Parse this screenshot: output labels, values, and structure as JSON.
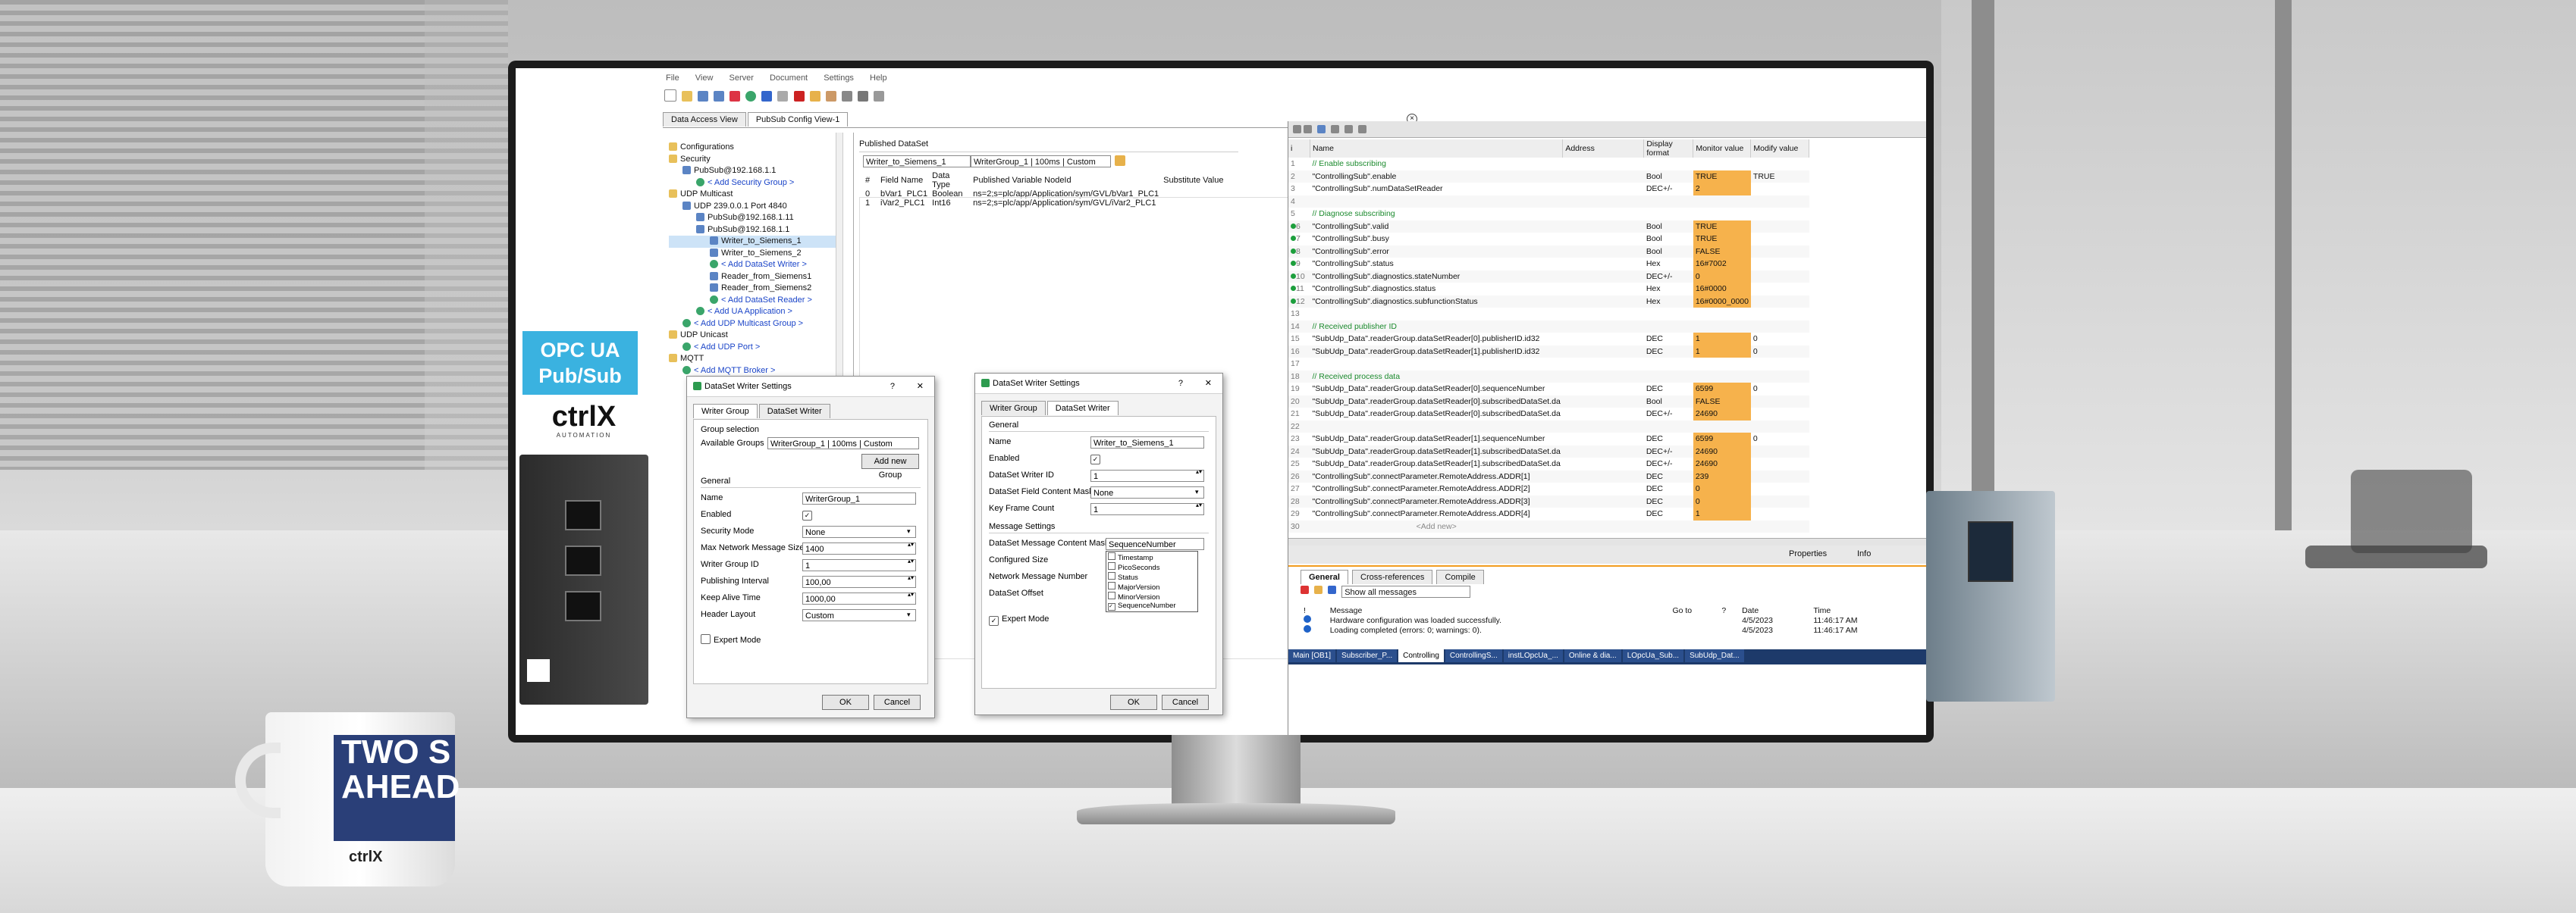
{
  "marketing": {
    "badge_line1": "OPC UA",
    "badge_line2": "Pub/Sub",
    "brand_logo_text": "ctrlX",
    "brand_sub": "AUTOMATION",
    "mug_text_1": "TWO S",
    "mug_text_2": "AHEAD",
    "mug_logo": "ctrlX"
  },
  "left_app": {
    "menu": [
      "File",
      "View",
      "Server",
      "Document",
      "Settings",
      "Help"
    ],
    "tabs": [
      "Data Access View",
      "PubSub Config View-1"
    ],
    "tree": [
      {
        "label": "Configurations",
        "indent": 0,
        "icon": "folder"
      },
      {
        "label": "Security",
        "indent": 0,
        "icon": "folder"
      },
      {
        "label": "PubSub@192.168.1.1",
        "indent": 1,
        "icon": "node"
      },
      {
        "label": "< Add Security Group >",
        "indent": 2,
        "icon": "plus",
        "link": true
      },
      {
        "label": "UDP Multicast",
        "indent": 0,
        "icon": "folder"
      },
      {
        "label": "UDP 239.0.0.1 Port 4840",
        "indent": 1,
        "icon": "node"
      },
      {
        "label": "PubSub@192.168.1.11",
        "indent": 2,
        "icon": "node"
      },
      {
        "label": "PubSub@192.168.1.1",
        "indent": 2,
        "icon": "node"
      },
      {
        "label": "Writer_to_Siemens_1",
        "indent": 3,
        "icon": "node",
        "selected": true
      },
      {
        "label": "Writer_to_Siemens_2",
        "indent": 3,
        "icon": "node"
      },
      {
        "label": "< Add DataSet Writer >",
        "indent": 3,
        "icon": "plus",
        "link": true
      },
      {
        "label": "Reader_from_Siemens1",
        "indent": 3,
        "icon": "node"
      },
      {
        "label": "Reader_from_Siemens2",
        "indent": 3,
        "icon": "node"
      },
      {
        "label": "< Add DataSet Reader >",
        "indent": 3,
        "icon": "plus",
        "link": true
      },
      {
        "label": "< Add UA Application >",
        "indent": 2,
        "icon": "plus",
        "link": true
      },
      {
        "label": "< Add UDP Multicast Group >",
        "indent": 1,
        "icon": "plus",
        "link": true
      },
      {
        "label": "UDP Unicast",
        "indent": 0,
        "icon": "folder"
      },
      {
        "label": "< Add UDP Port >",
        "indent": 1,
        "icon": "plus",
        "link": true
      },
      {
        "label": "MQTT",
        "indent": 0,
        "icon": "folder"
      },
      {
        "label": "< Add MQTT Broker >",
        "indent": 1,
        "icon": "plus",
        "link": true
      }
    ],
    "published": {
      "title": "Published DataSet",
      "writer_value": "Writer_to_Siemens_1",
      "group_value": "WriterGroup_1 | 100ms | Custom",
      "headers": [
        "#",
        "Field Name",
        "Data Type",
        "Published Variable NodeId",
        "Substitute Value"
      ],
      "rows": [
        [
          "0",
          "bVar1_PLC1",
          "Boolean",
          "ns=2;s=plc/app/Application/sym/GVL/bVar1_PLC1",
          ""
        ],
        [
          "1",
          "iVar2_PLC1",
          "Int16",
          "ns=2;s=plc/app/Application/sym/GVL/iVar2_PLC1",
          ""
        ]
      ]
    }
  },
  "dialog1": {
    "title": "DataSet Writer Settings",
    "tabs": [
      "Writer Group",
      "DataSet Writer"
    ],
    "group_selection": "Group selection",
    "available_groups_label": "Available Groups",
    "available_groups_value": "WriterGroup_1 | 100ms | Custom",
    "add_new_group": "Add new Group",
    "general": "General",
    "fields": [
      {
        "label": "Name",
        "value": "WriterGroup_1",
        "kind": "text"
      },
      {
        "label": "Enabled",
        "value": "",
        "kind": "check"
      },
      {
        "label": "Security Mode",
        "value": "None",
        "kind": "select"
      },
      {
        "label": "Max Network Message Size",
        "value": "1400",
        "kind": "spin"
      },
      {
        "label": "Writer Group ID",
        "value": "1",
        "kind": "spin"
      },
      {
        "label": "Publishing Interval",
        "value": "100,00",
        "kind": "spin"
      },
      {
        "label": "Keep Alive Time",
        "value": "1000,00",
        "kind": "spin"
      },
      {
        "label": "Header Layout",
        "value": "Custom",
        "kind": "select"
      }
    ],
    "expert_mode": "Expert Mode",
    "ok": "OK",
    "cancel": "Cancel"
  },
  "dialog2": {
    "title": "DataSet Writer Settings",
    "tabs": [
      "Writer Group",
      "DataSet Writer"
    ],
    "general": "General",
    "fields": [
      {
        "label": "Name",
        "value": "Writer_to_Siemens_1",
        "kind": "text"
      },
      {
        "label": "Enabled",
        "value": "",
        "kind": "check"
      },
      {
        "label": "DataSet Writer ID",
        "value": "1",
        "kind": "spin"
      },
      {
        "label": "DataSet Field Content Mask",
        "value": "None",
        "kind": "select"
      },
      {
        "label": "Key Frame Count",
        "value": "1",
        "kind": "spin"
      }
    ],
    "message_settings": "Message Settings",
    "msg_fields": [
      {
        "label": "DataSet Message Content Mask",
        "value": "SequenceNumber"
      },
      {
        "label": "Configured Size",
        "value": ""
      },
      {
        "label": "Network Message Number",
        "value": ""
      },
      {
        "label": "DataSet Offset",
        "value": ""
      }
    ],
    "mask_options": [
      "Timestamp",
      "PicoSeconds",
      "Status",
      "MajorVersion",
      "MinorVersion",
      "SequenceNumber"
    ],
    "expert_mode": "Expert Mode",
    "ok": "OK",
    "cancel": "Cancel"
  },
  "right_app": {
    "headers": [
      "i",
      "Name",
      "Address",
      "Display format",
      "Monitor value",
      "Modify value"
    ],
    "rows": [
      {
        "n": "1",
        "name": "// Enable subscribing",
        "fmt": "",
        "mon": "",
        "mod": "",
        "comment": true
      },
      {
        "n": "2",
        "name": "\"ControllingSub\".enable",
        "fmt": "Bool",
        "mon": "TRUE",
        "mod": "TRUE",
        "led": false
      },
      {
        "n": "3",
        "name": "\"ControllingSub\".numDataSetReader",
        "fmt": "DEC+/-",
        "mon": "2",
        "mod": ""
      },
      {
        "n": "4",
        "name": "",
        "fmt": "",
        "mon": "",
        "mod": ""
      },
      {
        "n": "5",
        "name": "// Diagnose subscribing",
        "fmt": "",
        "mon": "",
        "mod": "",
        "comment": true
      },
      {
        "n": "6",
        "name": "\"ControllingSub\".valid",
        "fmt": "Bool",
        "mon": "TRUE",
        "mod": "",
        "led": true
      },
      {
        "n": "7",
        "name": "\"ControllingSub\".busy",
        "fmt": "Bool",
        "mon": "TRUE",
        "mod": "",
        "led": true
      },
      {
        "n": "8",
        "name": "\"ControllingSub\".error",
        "fmt": "Bool",
        "mon": "FALSE",
        "mod": "",
        "led": true
      },
      {
        "n": "9",
        "name": "\"ControllingSub\".status",
        "fmt": "Hex",
        "mon": "16#7002",
        "mod": "",
        "led": true
      },
      {
        "n": "10",
        "name": "\"ControllingSub\".diagnostics.stateNumber",
        "fmt": "DEC+/-",
        "mon": "0",
        "mod": "",
        "led": true
      },
      {
        "n": "11",
        "name": "\"ControllingSub\".diagnostics.status",
        "fmt": "Hex",
        "mon": "16#0000",
        "mod": "",
        "led": true
      },
      {
        "n": "12",
        "name": "\"ControllingSub\".diagnostics.subfunctionStatus",
        "fmt": "Hex",
        "mon": "16#0000_0000",
        "mod": "",
        "led": true
      },
      {
        "n": "13",
        "name": "",
        "fmt": "",
        "mon": "",
        "mod": ""
      },
      {
        "n": "14",
        "name": "// Received publisher ID",
        "fmt": "",
        "mon": "",
        "mod": "",
        "comment": true
      },
      {
        "n": "15",
        "name": "\"SubUdp_Data\".readerGroup.dataSetReader[0].publisherID.id32",
        "fmt": "DEC",
        "mon": "1",
        "mod": "0"
      },
      {
        "n": "16",
        "name": "\"SubUdp_Data\".readerGroup.dataSetReader[1].publisherID.id32",
        "fmt": "DEC",
        "mon": "1",
        "mod": "0"
      },
      {
        "n": "17",
        "name": "",
        "fmt": "",
        "mon": "",
        "mod": ""
      },
      {
        "n": "18",
        "name": "// Received process data",
        "fmt": "",
        "mon": "",
        "mod": "",
        "comment": true
      },
      {
        "n": "19",
        "name": "\"SubUdp_Data\".readerGroup.dataSetReader[0].sequenceNumber",
        "fmt": "DEC",
        "mon": "6599",
        "mod": "0"
      },
      {
        "n": "20",
        "name": "\"SubUdp_Data\".readerGroup.dataSetReader[0].subscribedDataSet.da",
        "fmt": "Bool",
        "mon": "FALSE",
        "mod": ""
      },
      {
        "n": "21",
        "name": "\"SubUdp_Data\".readerGroup.dataSetReader[0].subscribedDataSet.da",
        "fmt": "DEC+/-",
        "mon": "24690",
        "mod": ""
      },
      {
        "n": "22",
        "name": "",
        "fmt": "",
        "mon": "",
        "mod": ""
      },
      {
        "n": "23",
        "name": "\"SubUdp_Data\".readerGroup.dataSetReader[1].sequenceNumber",
        "fmt": "DEC",
        "mon": "6599",
        "mod": "0"
      },
      {
        "n": "24",
        "name": "\"SubUdp_Data\".readerGroup.dataSetReader[1].subscribedDataSet.da",
        "fmt": "DEC+/-",
        "mon": "24690",
        "mod": ""
      },
      {
        "n": "25",
        "name": "\"SubUdp_Data\".readerGroup.dataSetReader[1].subscribedDataSet.da",
        "fmt": "DEC+/-",
        "mon": "24690",
        "mod": ""
      },
      {
        "n": "26",
        "name": "\"ControllingSub\".connectParameter.RemoteAddress.ADDR[1]",
        "fmt": "DEC",
        "mon": "239",
        "mod": ""
      },
      {
        "n": "27",
        "name": "\"ControllingSub\".connectParameter.RemoteAddress.ADDR[2]",
        "fmt": "DEC",
        "mon": "0",
        "mod": ""
      },
      {
        "n": "28",
        "name": "\"ControllingSub\".connectParameter.RemoteAddress.ADDR[3]",
        "fmt": "DEC",
        "mon": "0",
        "mod": ""
      },
      {
        "n": "29",
        "name": "\"ControllingSub\".connectParameter.RemoteAddress.ADDR[4]",
        "fmt": "DEC",
        "mon": "1",
        "mod": ""
      },
      {
        "n": "30",
        "name": "<Add new>",
        "fmt": "",
        "mon": "",
        "mod": "",
        "addnew": true
      }
    ],
    "properties_tab": "Properties",
    "info_tab": "Info",
    "bottom_tabs": [
      "General",
      "Cross-references",
      "Compile"
    ],
    "filter_value": "Show all messages",
    "msg_headers": [
      "!",
      "Message",
      "Go to",
      "?",
      "Date",
      "Time"
    ],
    "messages": [
      {
        "text": "Hardware configuration was loaded successfully.",
        "date": "4/5/2023",
        "time": "11:46:17 AM"
      },
      {
        "text": "Loading completed (errors: 0; warnings: 0).",
        "date": "4/5/2023",
        "time": "11:46:17 AM"
      }
    ],
    "taskbar": [
      "Main [OB1]",
      "Subscriber_P...",
      "Controlling",
      "ControllingS...",
      "instLOpcUa_...",
      "Online & dia...",
      "LOpcUa_Sub...",
      "SubUdp_Dat..."
    ]
  },
  "colors": {
    "accent_blue": "#3ab2e0",
    "monitor_orange": "#f6b24c",
    "tia_orange": "#f29c1e"
  }
}
